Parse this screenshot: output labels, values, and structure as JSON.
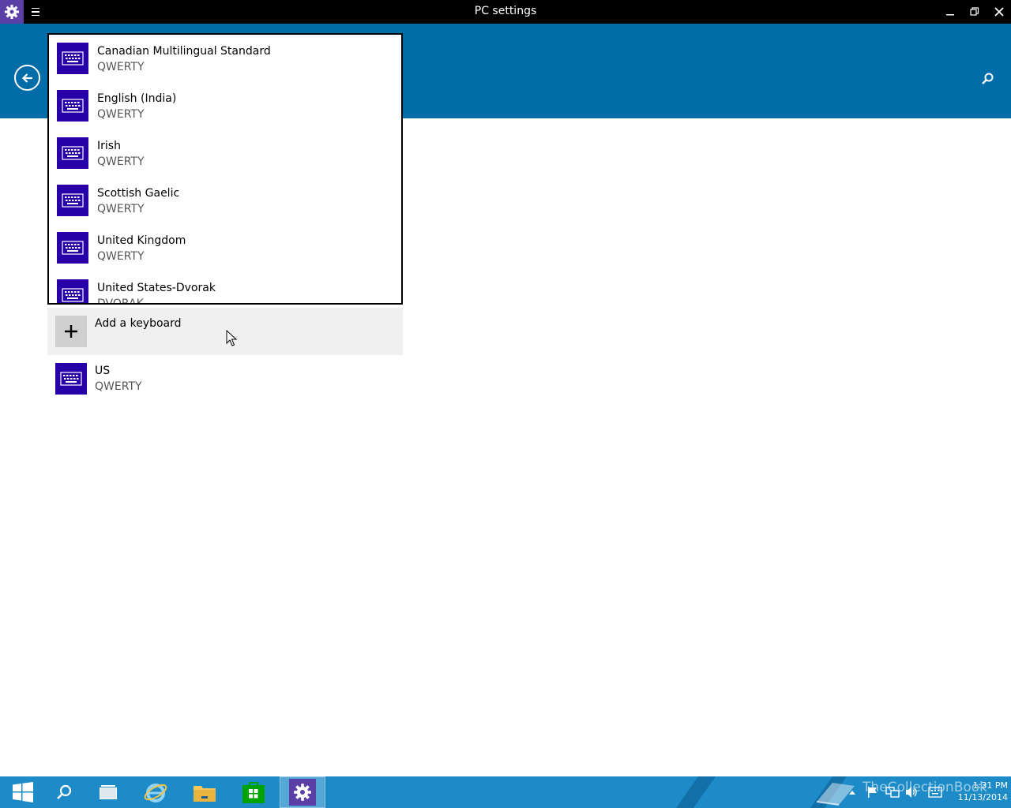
{
  "window": {
    "title": "PC settings"
  },
  "dropdown": {
    "items": [
      {
        "name": "Canadian Multilingual Standard",
        "layout": "QWERTY"
      },
      {
        "name": "English (India)",
        "layout": "QWERTY"
      },
      {
        "name": "Irish",
        "layout": "QWERTY"
      },
      {
        "name": "Scottish Gaelic",
        "layout": "QWERTY"
      },
      {
        "name": "United Kingdom",
        "layout": "QWERTY"
      },
      {
        "name": "United States-Dvorak",
        "layout": "DVORAK"
      }
    ]
  },
  "add_keyboard": {
    "label": "Add a keyboard"
  },
  "installed_keyboard": {
    "name": "US",
    "layout": "QWERTY"
  },
  "taskbar": {
    "apps": [
      "start-icon",
      "search-icon",
      "task-view-icon",
      "internet-explorer-icon",
      "file-explorer-icon",
      "store-icon",
      "settings-icon"
    ],
    "active_app": "settings-icon",
    "time": "1:31 PM",
    "date": "11/13/2014",
    "watermark": "TheCollectionBook"
  },
  "colors": {
    "header": "#006ca8",
    "keyboard_tile": "#2800a8",
    "taskbar": "#1d8bc7"
  }
}
